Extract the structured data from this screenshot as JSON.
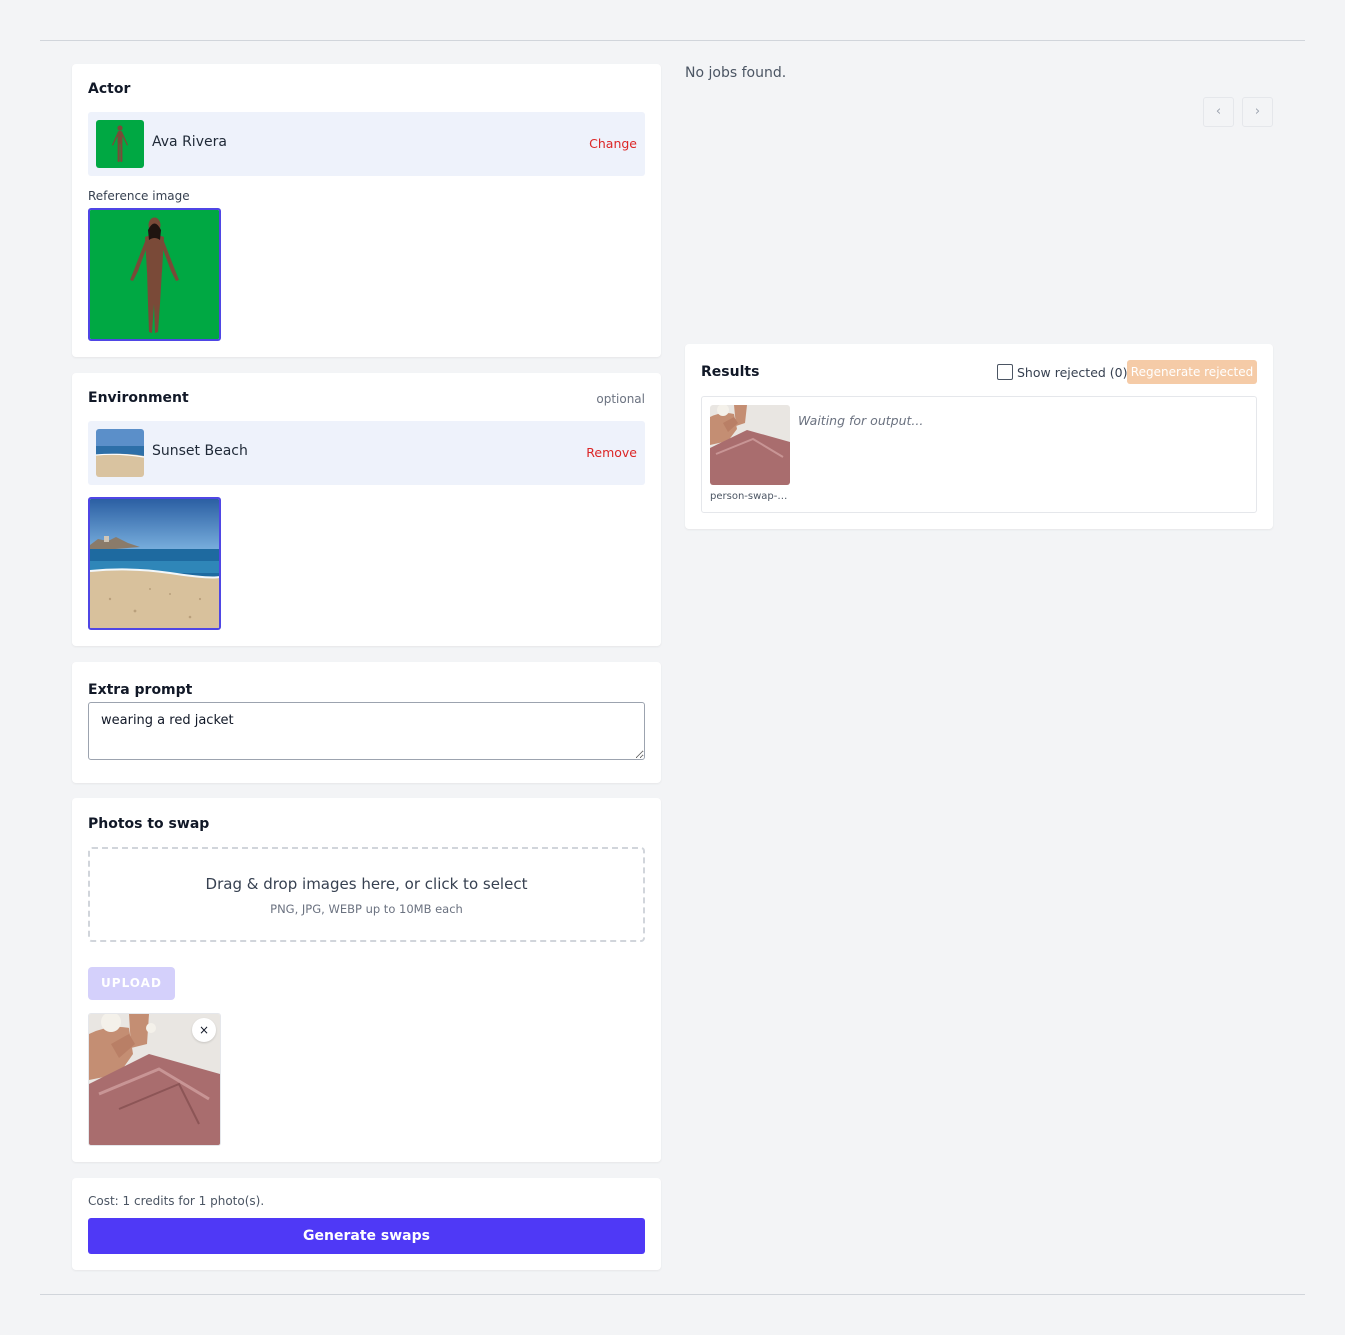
{
  "actor": {
    "title": "Actor",
    "name": "Ava Rivera",
    "action_label": "Change",
    "reference_label": "Reference image"
  },
  "environment": {
    "title": "Environment",
    "optional_label": "optional",
    "name": "Sunset Beach",
    "action_label": "Remove"
  },
  "extra_prompt": {
    "title": "Extra prompt",
    "value": "wearing a red jacket"
  },
  "photos": {
    "title": "Photos to swap",
    "dropzone_main": "Drag & drop images here, or click to select",
    "dropzone_sub": "PNG, JPG, WEBP up to 10MB each",
    "upload_label": "UPLOAD",
    "remove_symbol": "×"
  },
  "generate": {
    "cost_text": "Cost: 1 credits for 1 photo(s).",
    "button_label": "Generate swaps"
  },
  "jobs": {
    "empty_text": "No jobs found.",
    "prev_symbol": "‹",
    "next_symbol": "›"
  },
  "results": {
    "title": "Results",
    "show_rejected_label": "Show rejected (0)",
    "regenerate_label": "Regenerate rejected",
    "items": [
      {
        "filename": "person-swap-in...",
        "status": "Waiting for output..."
      }
    ]
  },
  "colors": {
    "accent": "#4f39f6",
    "danger": "#dc2626",
    "green_screen": "#00a843",
    "regenerate_disabled": "#f5cba7"
  }
}
